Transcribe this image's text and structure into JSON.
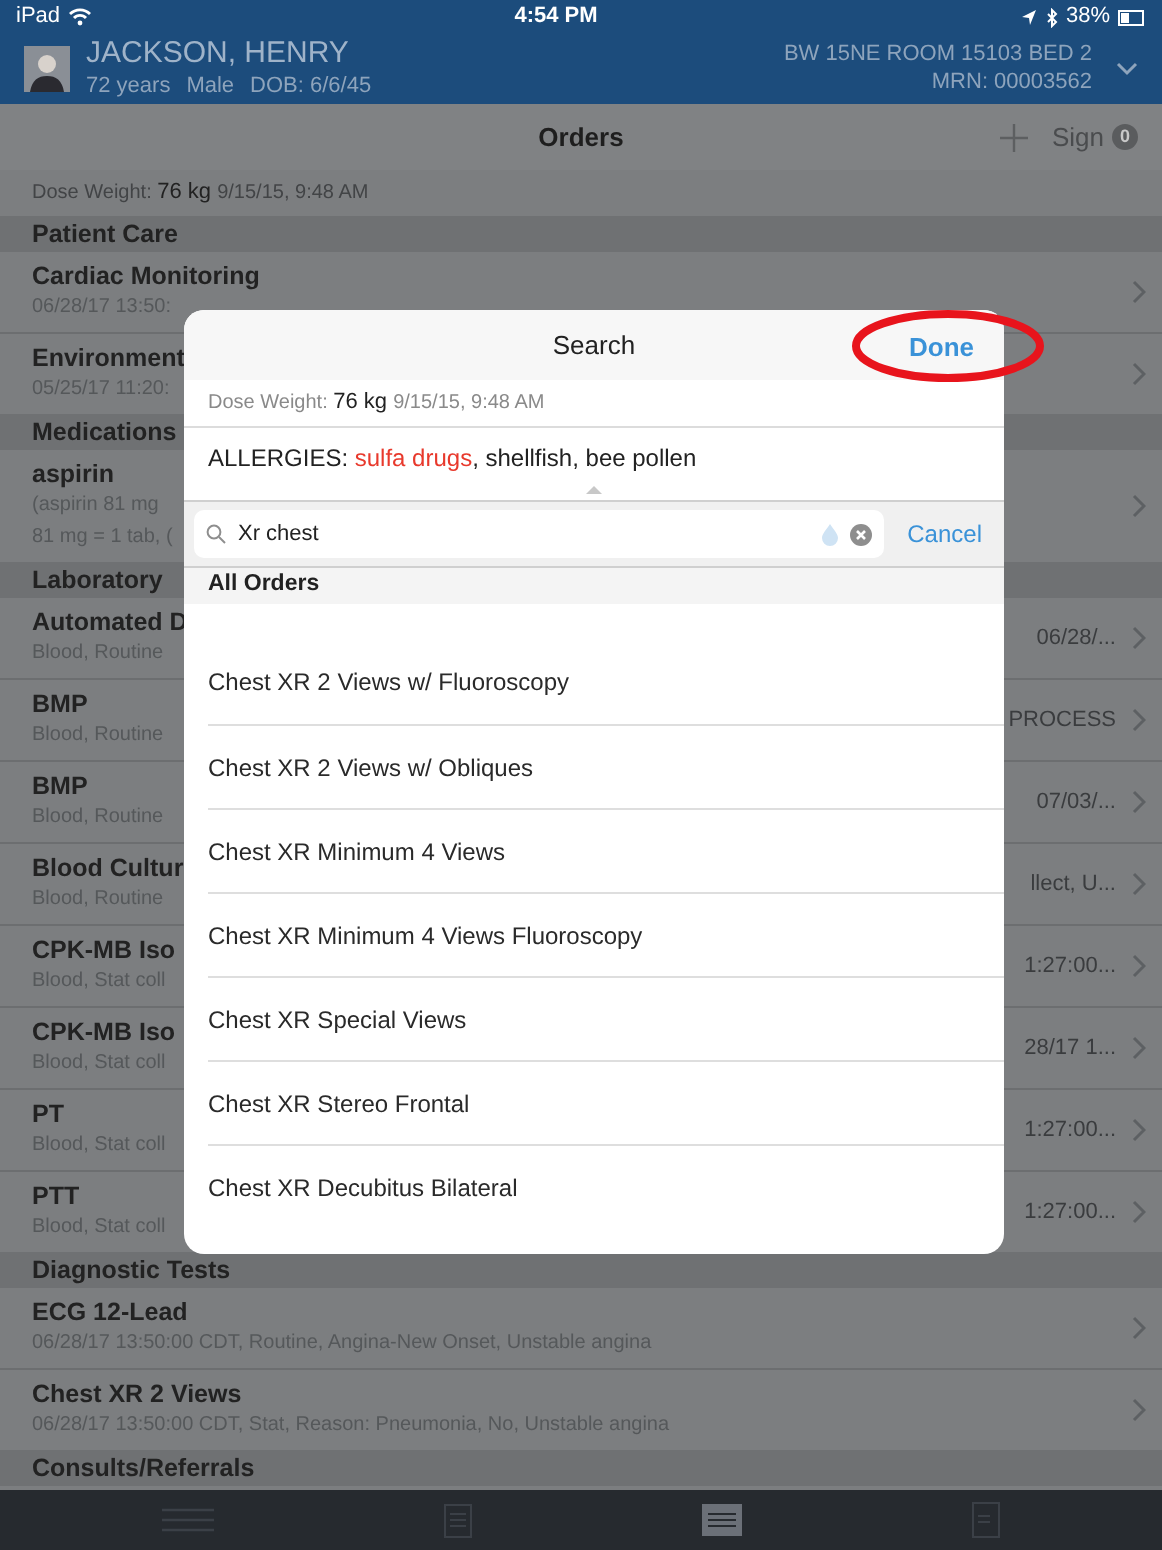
{
  "status_bar": {
    "carrier": "iPad",
    "time": "4:54 PM",
    "battery": "38%"
  },
  "patient": {
    "name": "JACKSON, HENRY",
    "age": "72 years",
    "sex": "Male",
    "dob": "DOB: 6/6/45",
    "location": "BW 15NE ROOM 15103 BED 2",
    "mrn": "MRN: 00003562"
  },
  "nav": {
    "title": "Orders",
    "sign": "Sign",
    "sign_count": "0"
  },
  "dose_weight": {
    "label": "Dose Weight:",
    "value": "76 kg",
    "time": "9/15/15, 9:48 AM"
  },
  "sections": [
    {
      "title": "Patient Care",
      "rows": [
        {
          "title": "Cardiac Monitoring",
          "lines": [
            "06/28/17 13:50:"
          ]
        },
        {
          "title": "Environment",
          "lines": [
            "05/25/17 11:20:"
          ]
        }
      ]
    },
    {
      "title": "Medications",
      "rows": [
        {
          "title": "aspirin",
          "lines": [
            "(aspirin 81 mg",
            "81 mg = 1 tab, ("
          ]
        }
      ]
    },
    {
      "title": "Laboratory",
      "rows": [
        {
          "title": "Automated D",
          "lines": [
            "Blood, Routine"
          ],
          "right": "06/28/..."
        },
        {
          "title": "BMP",
          "lines": [
            "Blood, Routine"
          ],
          "right": "PROCESS"
        },
        {
          "title": "BMP",
          "lines": [
            "Blood, Routine"
          ],
          "right": "07/03/..."
        },
        {
          "title": "Blood Cultur",
          "lines": [
            "Blood, Routine"
          ],
          "right": "llect, U..."
        },
        {
          "title": "CPK-MB Iso",
          "lines": [
            "Blood, Stat coll"
          ],
          "right": "1:27:00..."
        },
        {
          "title": "CPK-MB Iso",
          "lines": [
            "Blood, Stat coll"
          ],
          "right": "28/17 1..."
        },
        {
          "title": "PT",
          "lines": [
            "Blood, Stat coll"
          ],
          "right": "1:27:00..."
        },
        {
          "title": "PTT",
          "lines": [
            "Blood, Stat coll"
          ],
          "right": "1:27:00..."
        }
      ]
    },
    {
      "title": "Diagnostic Tests",
      "rows": [
        {
          "title": "ECG 12-Lead",
          "lines": [
            "06/28/17 13:50:00 CDT, Routine, Angina-New Onset, Unstable angina"
          ]
        },
        {
          "title": "Chest XR 2 Views",
          "lines": [
            "06/28/17 13:50:00 CDT, Stat, Reason: Pneumonia, No, Unstable angina"
          ]
        }
      ]
    },
    {
      "title": "Consults/Referrals"
    }
  ],
  "modal": {
    "title": "Search",
    "done": "Done",
    "dose_weight": {
      "label": "Dose Weight:",
      "value": "76 kg",
      "time": "9/15/15, 9:48 AM"
    },
    "allergies": [
      {
        "text": "ALLERGIES: ",
        "severe": false
      },
      {
        "text": "sulfa drugs",
        "severe": true
      },
      {
        "text": ", shellfish, bee pollen",
        "severe": false
      }
    ],
    "search": {
      "value": "Xr chest",
      "cancel": "Cancel"
    },
    "list_header": "All Orders",
    "results": [
      "Chest XR 2 Views w/ Fluoroscopy",
      "Chest XR 2 Views w/ Obliques",
      "Chest XR Minimum 4 Views",
      "Chest XR Minimum 4 Views Fluoroscopy",
      "Chest XR Special Views",
      "Chest XR Stereo Frontal",
      "Chest XR Decubitus Bilateral"
    ]
  },
  "tab_bar": [
    {
      "kind": "menu",
      "selected": false
    },
    {
      "kind": "review",
      "selected": false
    },
    {
      "kind": "order",
      "selected": true
    },
    {
      "kind": "document",
      "selected": false
    }
  ]
}
